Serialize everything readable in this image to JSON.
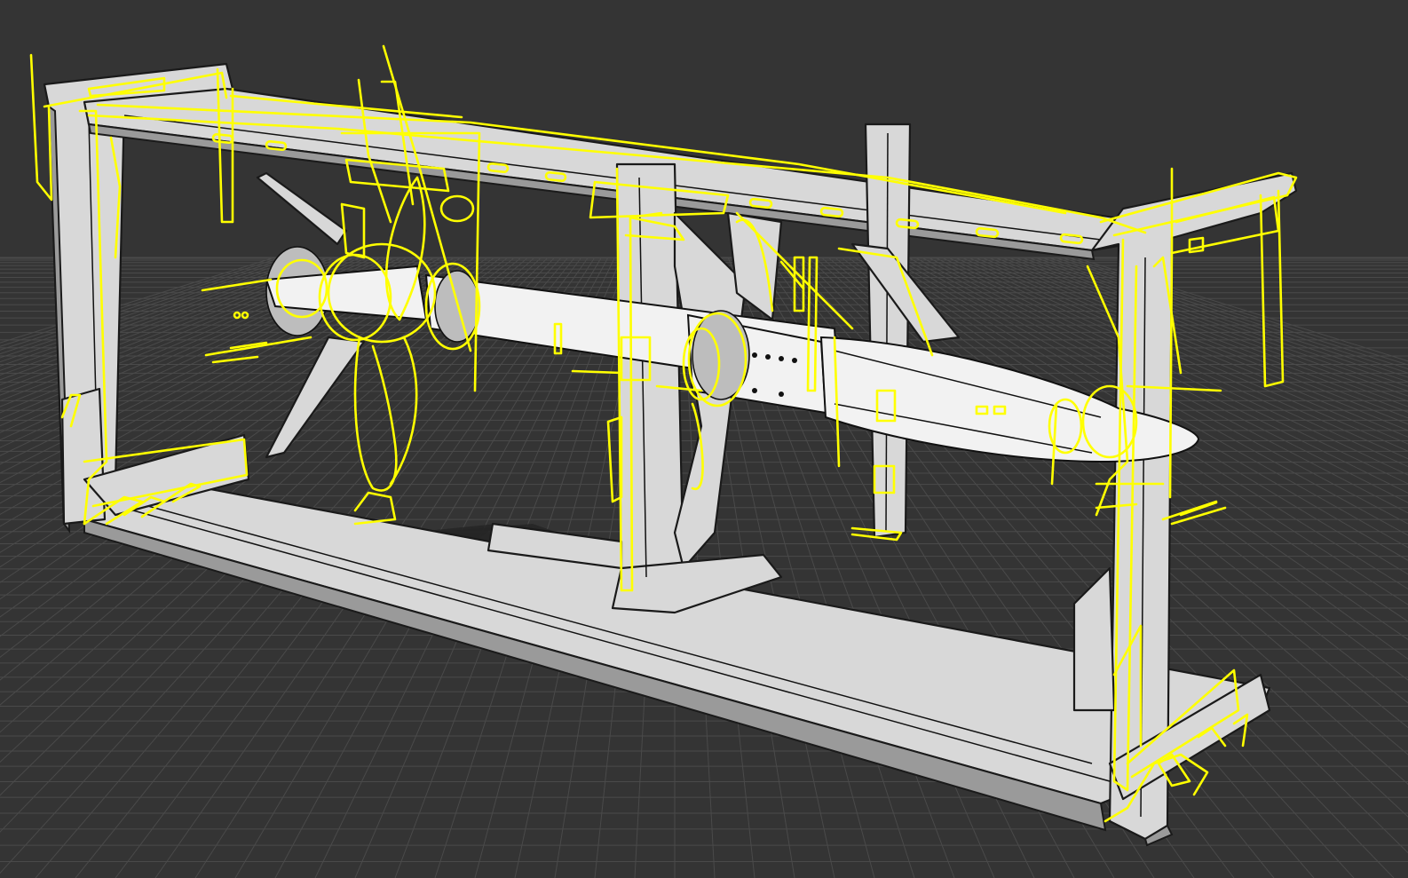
{
  "app": {
    "view": "perspective-viewport",
    "display_mode": "technical-shaded"
  },
  "colors": {
    "background": "#343434",
    "grid": "#4a4a4a",
    "selection": "#ffff00",
    "model_fill": "#d8d8d8",
    "model_edge": "#1a1a1a"
  },
  "scene": {
    "objects": [
      {
        "name": "rack-frame",
        "selected": true
      },
      {
        "name": "missile-body",
        "selected": true
      },
      {
        "name": "center-support",
        "selected": true
      },
      {
        "name": "rear-fins",
        "selected": true
      },
      {
        "name": "base-rail",
        "selected": false
      }
    ]
  },
  "icons": [
    "viewport-grid",
    "selection-curves"
  ]
}
